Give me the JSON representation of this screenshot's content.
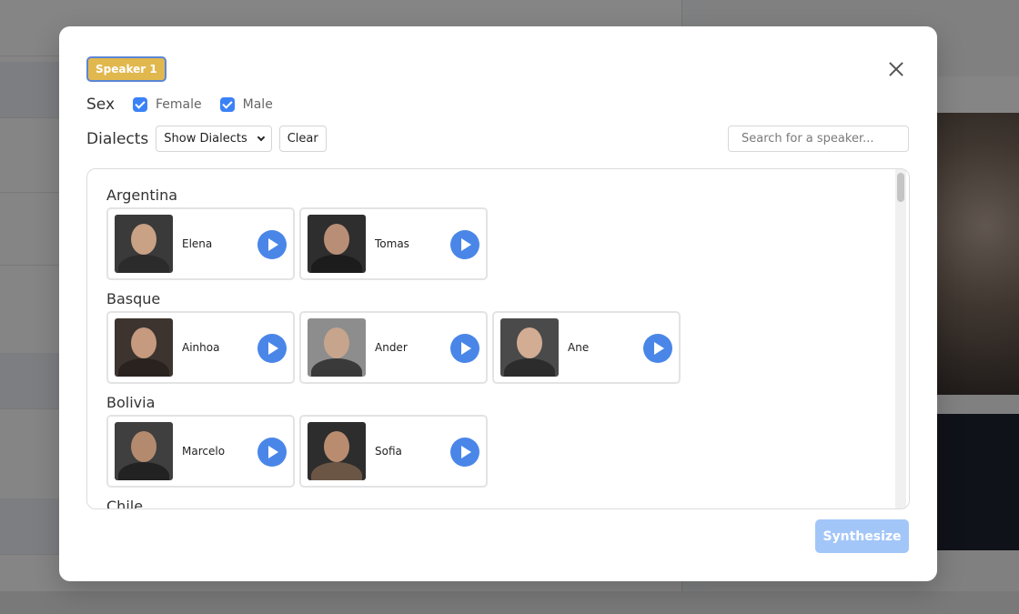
{
  "modal": {
    "speaker_badge": "Speaker 1",
    "sex_label": "Sex",
    "sex_options": [
      {
        "label": "Female",
        "checked": true
      },
      {
        "label": "Male",
        "checked": true
      }
    ],
    "dialects_label": "Dialects",
    "dialects_dropdown": "Show Dialects",
    "clear_label": "Clear",
    "search_placeholder": "Search for a speaker...",
    "synthesize_label": "Synthesize",
    "accent_color": "#4a86e8",
    "badge_color": "#e1b84e",
    "groups": [
      {
        "name": "Argentina",
        "speakers": [
          {
            "name": "Elena",
            "avatar": "portrait-woman-icon"
          },
          {
            "name": "Tomas",
            "avatar": "portrait-man-icon"
          }
        ]
      },
      {
        "name": "Basque",
        "speakers": [
          {
            "name": "Ainhoa",
            "avatar": "portrait-woman-icon"
          },
          {
            "name": "Ander",
            "avatar": "portrait-man-icon"
          },
          {
            "name": "Ane",
            "avatar": "portrait-woman-icon"
          }
        ]
      },
      {
        "name": "Bolivia",
        "speakers": [
          {
            "name": "Marcelo",
            "avatar": "portrait-man-icon"
          },
          {
            "name": "Sofia",
            "avatar": "portrait-woman-icon"
          }
        ]
      },
      {
        "name": "Chile",
        "speakers": []
      }
    ]
  }
}
